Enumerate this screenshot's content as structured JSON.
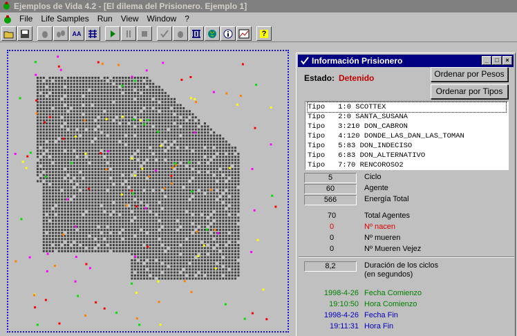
{
  "window": {
    "title": "Ejemplos de Vida 4.2 - [El dilema del Prisionero. Ejemplo 1]"
  },
  "menu": [
    "File",
    "Life Samples",
    "Run",
    "View",
    "Window",
    "?"
  ],
  "toolbar": {
    "buttons": [
      "open-icon",
      "save-icon",
      "agent-icon",
      "agents-icon",
      "font-icon",
      "grid-icon",
      "play-icon",
      "pause-icon",
      "stop-icon",
      "check-icon",
      "agent-icon",
      "network-icon",
      "globe-icon",
      "info-icon",
      "chart-icon",
      "help-icon"
    ],
    "font_label": "AA",
    "help_label": "?"
  },
  "panel": {
    "title": "Información Prisionero",
    "estado_label": "Estado:",
    "estado_value": "Detenido",
    "btn_pesos": "Ordenar por Pesos",
    "btn_tipos": "Ordenar por Tipos",
    "types": [
      "Tipo   1:0 SCOTTEX",
      "Tipo   2:0 SANTA_SUSANA",
      "Tipo   3:210 DON_CABRON",
      "Tipo   4:120 DONDE_LAS_DAN_LAS_TOMAN",
      "Tipo   5:83 DON_INDECISO",
      "Tipo   6:83 DON_ALTERNATIVO",
      "Tipo   7:70 RENCOROSO2"
    ],
    "ciclo": {
      "value": "5",
      "label": "Ciclo"
    },
    "agente": {
      "value": "60",
      "label": "Agente"
    },
    "energia": {
      "value": "566",
      "label": "Energía Total"
    },
    "total_agentes": {
      "value": "70",
      "label": "Total Agentes"
    },
    "nacen": {
      "value": "0",
      "label": "Nº nacen"
    },
    "mueren": {
      "value": "0",
      "label": "Nº mueren"
    },
    "mueren_vejez": {
      "value": "0",
      "label": "Nº Mueren Vejez"
    },
    "duracion": {
      "value": "8,2",
      "label1": "Duración de los ciclos",
      "label2": "(en segundos)"
    },
    "fecha_comienzo": {
      "value": "1998-4-26",
      "label": "Fecha Comienzo"
    },
    "hora_comienzo": {
      "value": "19:10:50",
      "label": "Hora Comienzo"
    },
    "fecha_fin": {
      "value": "1998-4-26",
      "label": "Fecha Fin"
    },
    "hora_fin": {
      "value": "19:11:31",
      "label": "Hora Fin"
    }
  },
  "colors": {
    "title_bg": "#000080",
    "status_red": "#c00000",
    "green": "#008000",
    "blue": "#0000c0",
    "cell": "#404040",
    "border": "#1010e0"
  }
}
